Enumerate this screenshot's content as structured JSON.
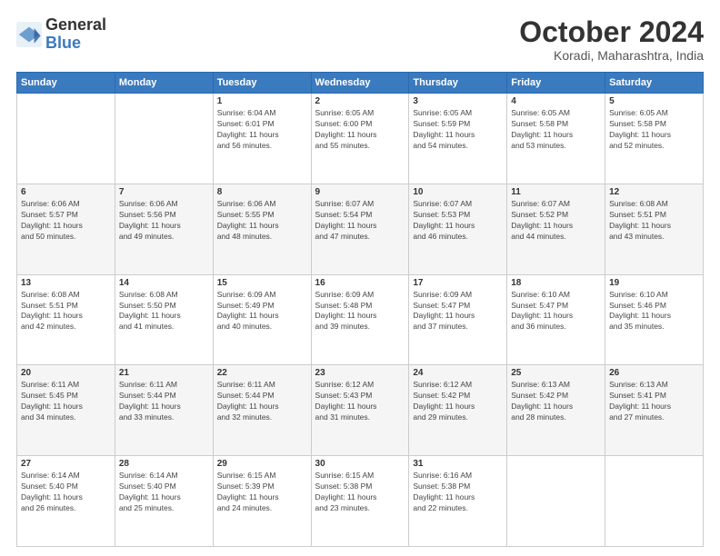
{
  "logo": {
    "line1": "General",
    "line2": "Blue"
  },
  "header": {
    "month": "October 2024",
    "location": "Koradi, Maharashtra, India"
  },
  "weekdays": [
    "Sunday",
    "Monday",
    "Tuesday",
    "Wednesday",
    "Thursday",
    "Friday",
    "Saturday"
  ],
  "weeks": [
    [
      {
        "day": "",
        "info": ""
      },
      {
        "day": "",
        "info": ""
      },
      {
        "day": "1",
        "info": "Sunrise: 6:04 AM\nSunset: 6:01 PM\nDaylight: 11 hours\nand 56 minutes."
      },
      {
        "day": "2",
        "info": "Sunrise: 6:05 AM\nSunset: 6:00 PM\nDaylight: 11 hours\nand 55 minutes."
      },
      {
        "day": "3",
        "info": "Sunrise: 6:05 AM\nSunset: 5:59 PM\nDaylight: 11 hours\nand 54 minutes."
      },
      {
        "day": "4",
        "info": "Sunrise: 6:05 AM\nSunset: 5:58 PM\nDaylight: 11 hours\nand 53 minutes."
      },
      {
        "day": "5",
        "info": "Sunrise: 6:05 AM\nSunset: 5:58 PM\nDaylight: 11 hours\nand 52 minutes."
      }
    ],
    [
      {
        "day": "6",
        "info": "Sunrise: 6:06 AM\nSunset: 5:57 PM\nDaylight: 11 hours\nand 50 minutes."
      },
      {
        "day": "7",
        "info": "Sunrise: 6:06 AM\nSunset: 5:56 PM\nDaylight: 11 hours\nand 49 minutes."
      },
      {
        "day": "8",
        "info": "Sunrise: 6:06 AM\nSunset: 5:55 PM\nDaylight: 11 hours\nand 48 minutes."
      },
      {
        "day": "9",
        "info": "Sunrise: 6:07 AM\nSunset: 5:54 PM\nDaylight: 11 hours\nand 47 minutes."
      },
      {
        "day": "10",
        "info": "Sunrise: 6:07 AM\nSunset: 5:53 PM\nDaylight: 11 hours\nand 46 minutes."
      },
      {
        "day": "11",
        "info": "Sunrise: 6:07 AM\nSunset: 5:52 PM\nDaylight: 11 hours\nand 44 minutes."
      },
      {
        "day": "12",
        "info": "Sunrise: 6:08 AM\nSunset: 5:51 PM\nDaylight: 11 hours\nand 43 minutes."
      }
    ],
    [
      {
        "day": "13",
        "info": "Sunrise: 6:08 AM\nSunset: 5:51 PM\nDaylight: 11 hours\nand 42 minutes."
      },
      {
        "day": "14",
        "info": "Sunrise: 6:08 AM\nSunset: 5:50 PM\nDaylight: 11 hours\nand 41 minutes."
      },
      {
        "day": "15",
        "info": "Sunrise: 6:09 AM\nSunset: 5:49 PM\nDaylight: 11 hours\nand 40 minutes."
      },
      {
        "day": "16",
        "info": "Sunrise: 6:09 AM\nSunset: 5:48 PM\nDaylight: 11 hours\nand 39 minutes."
      },
      {
        "day": "17",
        "info": "Sunrise: 6:09 AM\nSunset: 5:47 PM\nDaylight: 11 hours\nand 37 minutes."
      },
      {
        "day": "18",
        "info": "Sunrise: 6:10 AM\nSunset: 5:47 PM\nDaylight: 11 hours\nand 36 minutes."
      },
      {
        "day": "19",
        "info": "Sunrise: 6:10 AM\nSunset: 5:46 PM\nDaylight: 11 hours\nand 35 minutes."
      }
    ],
    [
      {
        "day": "20",
        "info": "Sunrise: 6:11 AM\nSunset: 5:45 PM\nDaylight: 11 hours\nand 34 minutes."
      },
      {
        "day": "21",
        "info": "Sunrise: 6:11 AM\nSunset: 5:44 PM\nDaylight: 11 hours\nand 33 minutes."
      },
      {
        "day": "22",
        "info": "Sunrise: 6:11 AM\nSunset: 5:44 PM\nDaylight: 11 hours\nand 32 minutes."
      },
      {
        "day": "23",
        "info": "Sunrise: 6:12 AM\nSunset: 5:43 PM\nDaylight: 11 hours\nand 31 minutes."
      },
      {
        "day": "24",
        "info": "Sunrise: 6:12 AM\nSunset: 5:42 PM\nDaylight: 11 hours\nand 29 minutes."
      },
      {
        "day": "25",
        "info": "Sunrise: 6:13 AM\nSunset: 5:42 PM\nDaylight: 11 hours\nand 28 minutes."
      },
      {
        "day": "26",
        "info": "Sunrise: 6:13 AM\nSunset: 5:41 PM\nDaylight: 11 hours\nand 27 minutes."
      }
    ],
    [
      {
        "day": "27",
        "info": "Sunrise: 6:14 AM\nSunset: 5:40 PM\nDaylight: 11 hours\nand 26 minutes."
      },
      {
        "day": "28",
        "info": "Sunrise: 6:14 AM\nSunset: 5:40 PM\nDaylight: 11 hours\nand 25 minutes."
      },
      {
        "day": "29",
        "info": "Sunrise: 6:15 AM\nSunset: 5:39 PM\nDaylight: 11 hours\nand 24 minutes."
      },
      {
        "day": "30",
        "info": "Sunrise: 6:15 AM\nSunset: 5:38 PM\nDaylight: 11 hours\nand 23 minutes."
      },
      {
        "day": "31",
        "info": "Sunrise: 6:16 AM\nSunset: 5:38 PM\nDaylight: 11 hours\nand 22 minutes."
      },
      {
        "day": "",
        "info": ""
      },
      {
        "day": "",
        "info": ""
      }
    ]
  ]
}
